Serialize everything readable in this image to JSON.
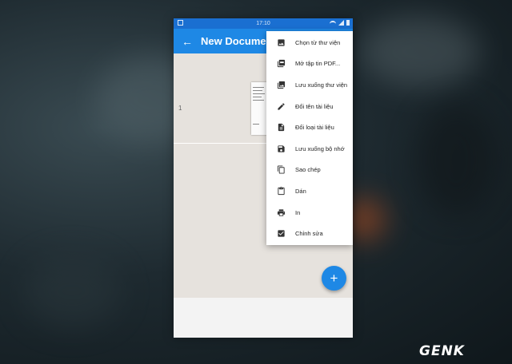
{
  "status_bar": {
    "time": "17:10"
  },
  "app_bar": {
    "title": "New Document"
  },
  "document": {
    "page_number": "1"
  },
  "menu": {
    "items": [
      {
        "label": "Chọn từ thư viện",
        "icon": "image-icon"
      },
      {
        "label": "Mở tập tin PDF...",
        "icon": "pdf-icon"
      },
      {
        "label": "Lưu xuống thư viện",
        "icon": "gallery-save-icon"
      },
      {
        "label": "Đổi tên tài liệu",
        "icon": "pencil-icon"
      },
      {
        "label": "Đổi loại tài liệu",
        "icon": "document-icon"
      },
      {
        "label": "Lưu xuống bộ nhớ",
        "icon": "floppy-icon"
      },
      {
        "label": "Sao chép",
        "icon": "copy-icon"
      },
      {
        "label": "Dán",
        "icon": "clipboard-icon"
      },
      {
        "label": "In",
        "icon": "printer-icon"
      },
      {
        "label": "Chỉnh sửa",
        "icon": "checkbox-icon"
      }
    ]
  },
  "fab": {
    "symbol": "+"
  },
  "watermark": {
    "logo": "GENK"
  },
  "colors": {
    "primary": "#1e88e5",
    "status_bar": "#1a6fd1",
    "content_bg": "#e6e2dd"
  }
}
